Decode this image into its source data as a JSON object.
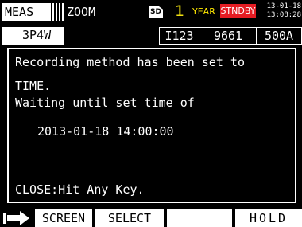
{
  "topbar": {
    "tab_meas": "MEAS",
    "tab_zoom": "ZOOM",
    "sd_label": "SD",
    "file_number": "1",
    "period": "YEAR",
    "status": "STNDBY",
    "date": "13-01-18",
    "time": "13:08:28"
  },
  "settings": {
    "wiring": "3P4W",
    "range_label": "I123",
    "range_value": "9661",
    "clamp": "500A"
  },
  "dialog": {
    "line1": "Recording method has been set to",
    "line2": "TIME.",
    "line3": "Waiting until set time of",
    "line4": "2013-01-18 14:00:00",
    "line5": "CLOSE:Hit Any Key."
  },
  "fkeys": {
    "screen": "SCREEN",
    "select": "SELECT",
    "empty": "",
    "hold": "HOLD"
  },
  "colors": {
    "background": "#000000",
    "status_badge": "#e51c23",
    "file_number": "#f0e010",
    "period": "#ffe800"
  },
  "icons": {
    "sd": "sd-card-icon",
    "function_arrow": "function-arrow-icon"
  }
}
